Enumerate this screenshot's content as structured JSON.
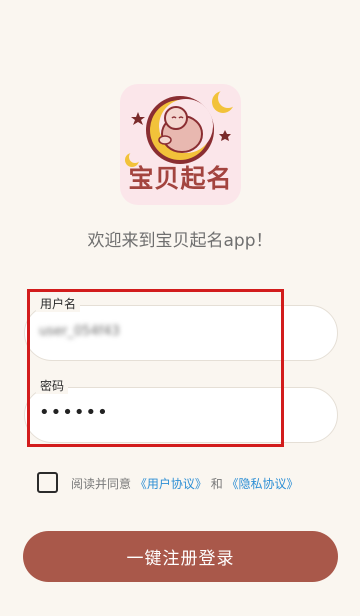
{
  "app": {
    "icon_text": "宝贝起名",
    "welcome": "欢迎来到宝贝起名app！"
  },
  "form": {
    "username_label": "用户名",
    "username_value": "user_054f43",
    "password_label": "密码",
    "password_value": "••••••"
  },
  "agreement": {
    "prefix": "阅读并同意",
    "user_agreement": "《用户协议》",
    "and": "和",
    "privacy_policy": "《隐私协议》",
    "checked": false
  },
  "login_button": "一键注册登录",
  "colors": {
    "background": "#faf6f0",
    "button": "#a9584a",
    "link": "#2d8fd5",
    "highlight": "#d21c1c"
  }
}
